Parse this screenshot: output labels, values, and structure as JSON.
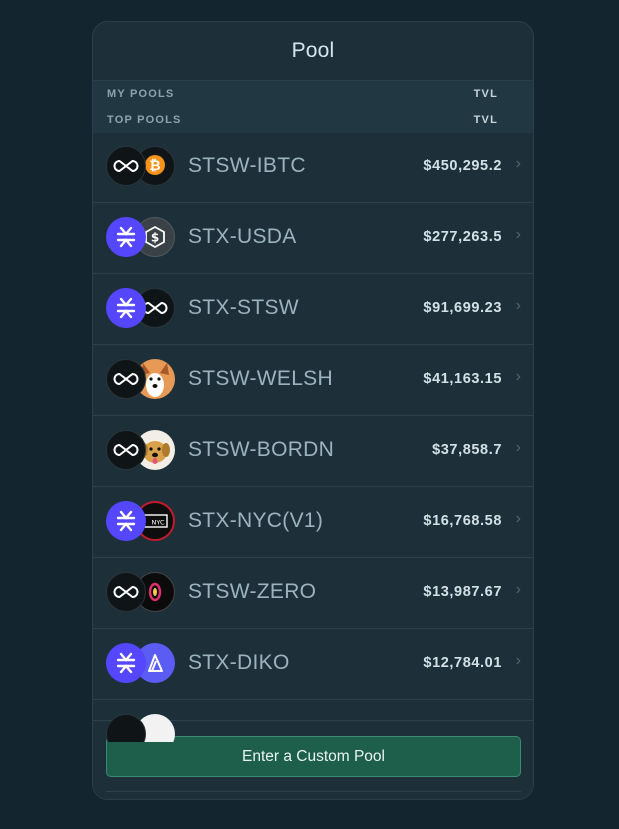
{
  "header": {
    "title": "Pool"
  },
  "sections": {
    "my_pools": {
      "label": "MY POOLS",
      "tvl_label": "TVL"
    },
    "top_pools": {
      "label": "TOP POOLS",
      "tvl_label": "TVL"
    }
  },
  "pools": [
    {
      "name": "STSW-IBTC",
      "tvl": "$450,295.2",
      "token_a": "stsw-icon",
      "token_b": "bitcoin-icon"
    },
    {
      "name": "STX-USDA",
      "tvl": "$277,263.5",
      "token_a": "stx-icon",
      "token_b": "usda-icon"
    },
    {
      "name": "STX-STSW",
      "tvl": "$91,699.23",
      "token_a": "stx-icon",
      "token_b": "stsw-icon"
    },
    {
      "name": "STSW-WELSH",
      "tvl": "$41,163.15",
      "token_a": "stsw-icon",
      "token_b": "welsh-dog-icon"
    },
    {
      "name": "STSW-BORDN",
      "tvl": "$37,858.7",
      "token_a": "stsw-icon",
      "token_b": "bordn-dog-icon"
    },
    {
      "name": "STX-NYC(V1)",
      "tvl": "$16,768.58",
      "token_a": "stx-icon",
      "token_b": "nyc-icon"
    },
    {
      "name": "STSW-ZERO",
      "tvl": "$13,987.67",
      "token_a": "stsw-icon",
      "token_b": "zero-icon"
    },
    {
      "name": "STX-DIKO",
      "tvl": "$12,784.01",
      "token_a": "stx-icon",
      "token_b": "diko-icon"
    }
  ],
  "footer": {
    "button_label": "Enter a Custom Pool"
  },
  "colors": {
    "background": "#13252e",
    "panel": "#1d303a",
    "accent": "#1e5f4c",
    "stx_purple": "#5546ff"
  }
}
